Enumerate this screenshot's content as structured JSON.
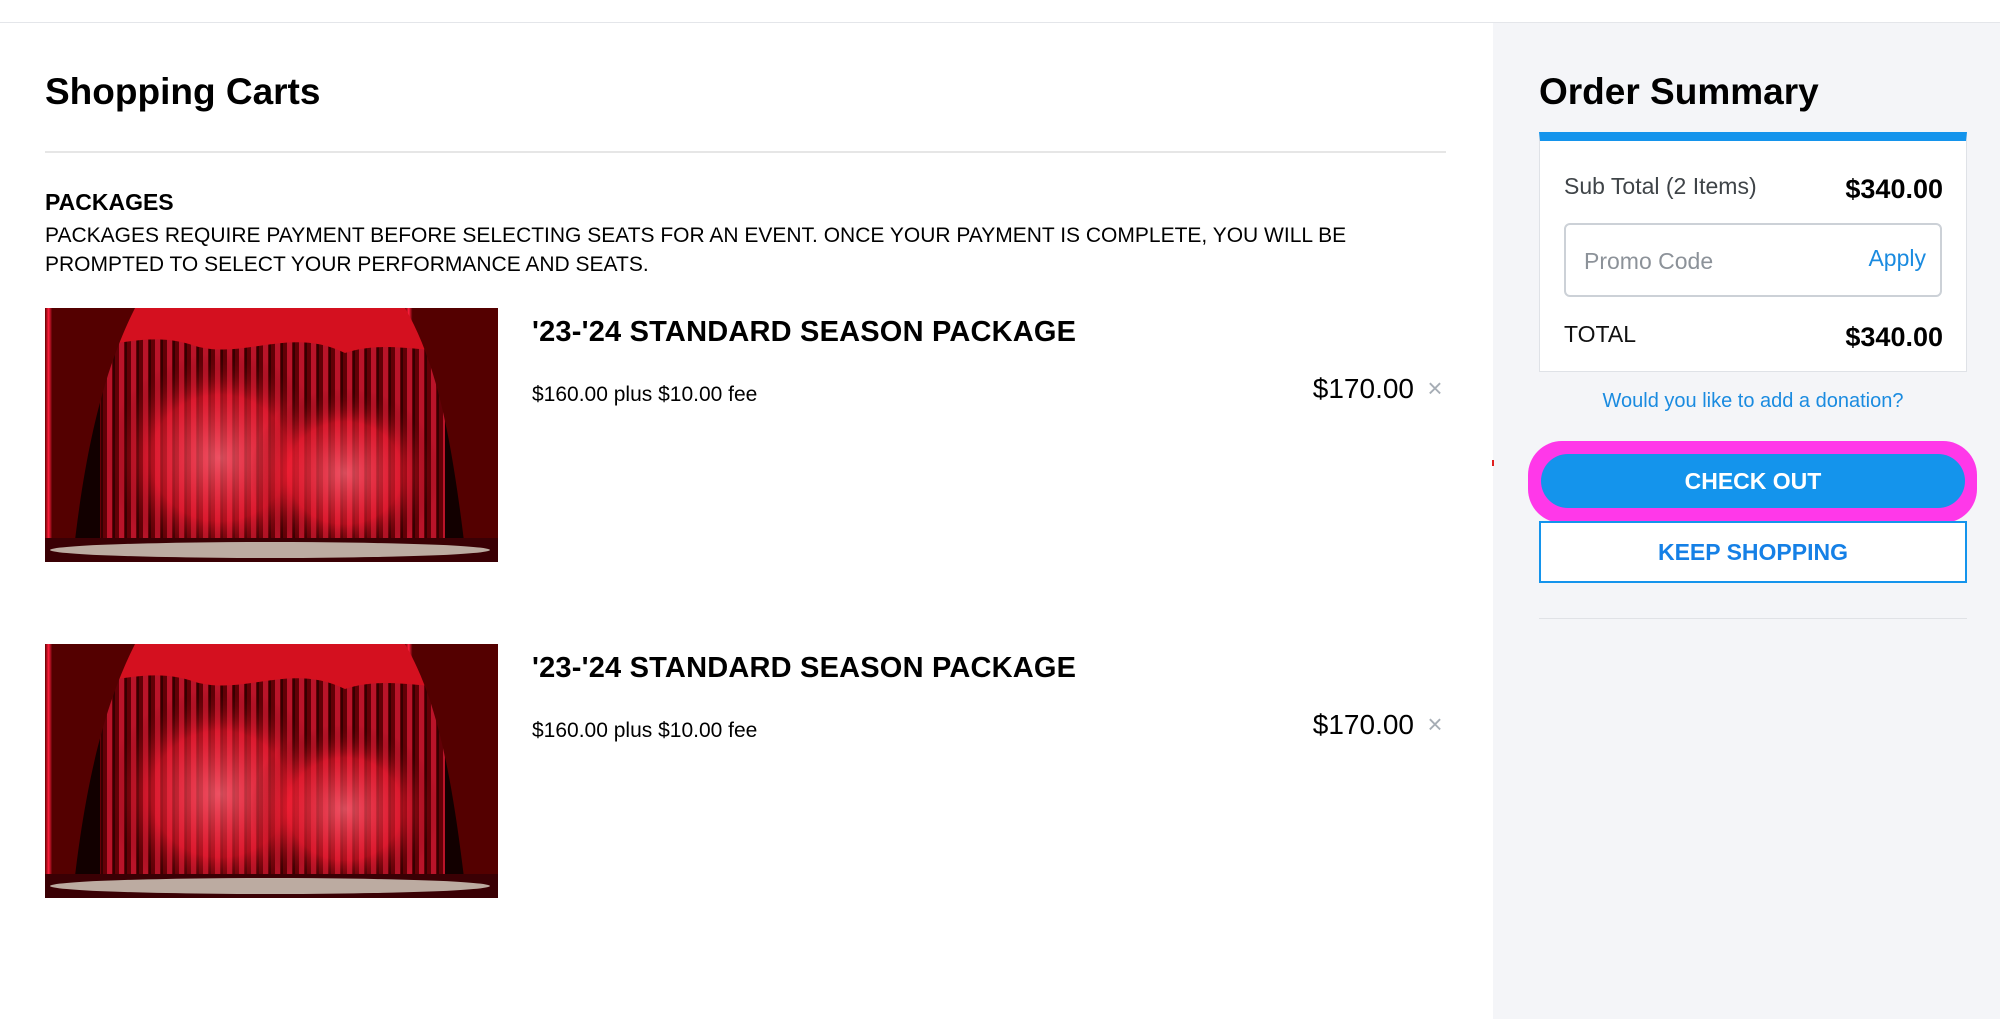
{
  "cart": {
    "title": "Shopping Carts",
    "section_heading": "PACKAGES",
    "section_note": "PACKAGES REQUIRE PAYMENT BEFORE SELECTING SEATS FOR AN EVENT. ONCE YOUR PAYMENT IS COMPLETE, YOU WILL BE PROMPTED TO SELECT YOUR PERFORMANCE AND SEATS.",
    "items": [
      {
        "title": "'23-'24 STANDARD SEASON PACKAGE",
        "detail": "$160.00 plus $10.00 fee",
        "price": "$170.00",
        "remove_icon": "close-icon",
        "image": "theater-curtain-spotlight"
      },
      {
        "title": "'23-'24 STANDARD SEASON PACKAGE",
        "detail": "$160.00 plus $10.00 fee",
        "price": "$170.00",
        "remove_icon": "close-icon",
        "image": "theater-curtain-spotlight"
      }
    ]
  },
  "summary": {
    "title": "Order Summary",
    "subtotal_label": "Sub Total (2 Items)",
    "subtotal_value": "$340.00",
    "promo_placeholder": "Promo Code",
    "apply_label": "Apply",
    "total_label": "TOTAL",
    "total_value": "$340.00",
    "donation_link": "Would you like to add a donation?",
    "checkout_label": "CHECK OUT",
    "keep_shopping_label": "KEEP SHOPPING"
  },
  "colors": {
    "accent": "#1494ec",
    "link": "#1a8be0",
    "highlight": "#ff38e9",
    "panel_bg": "#f4f5f8"
  }
}
